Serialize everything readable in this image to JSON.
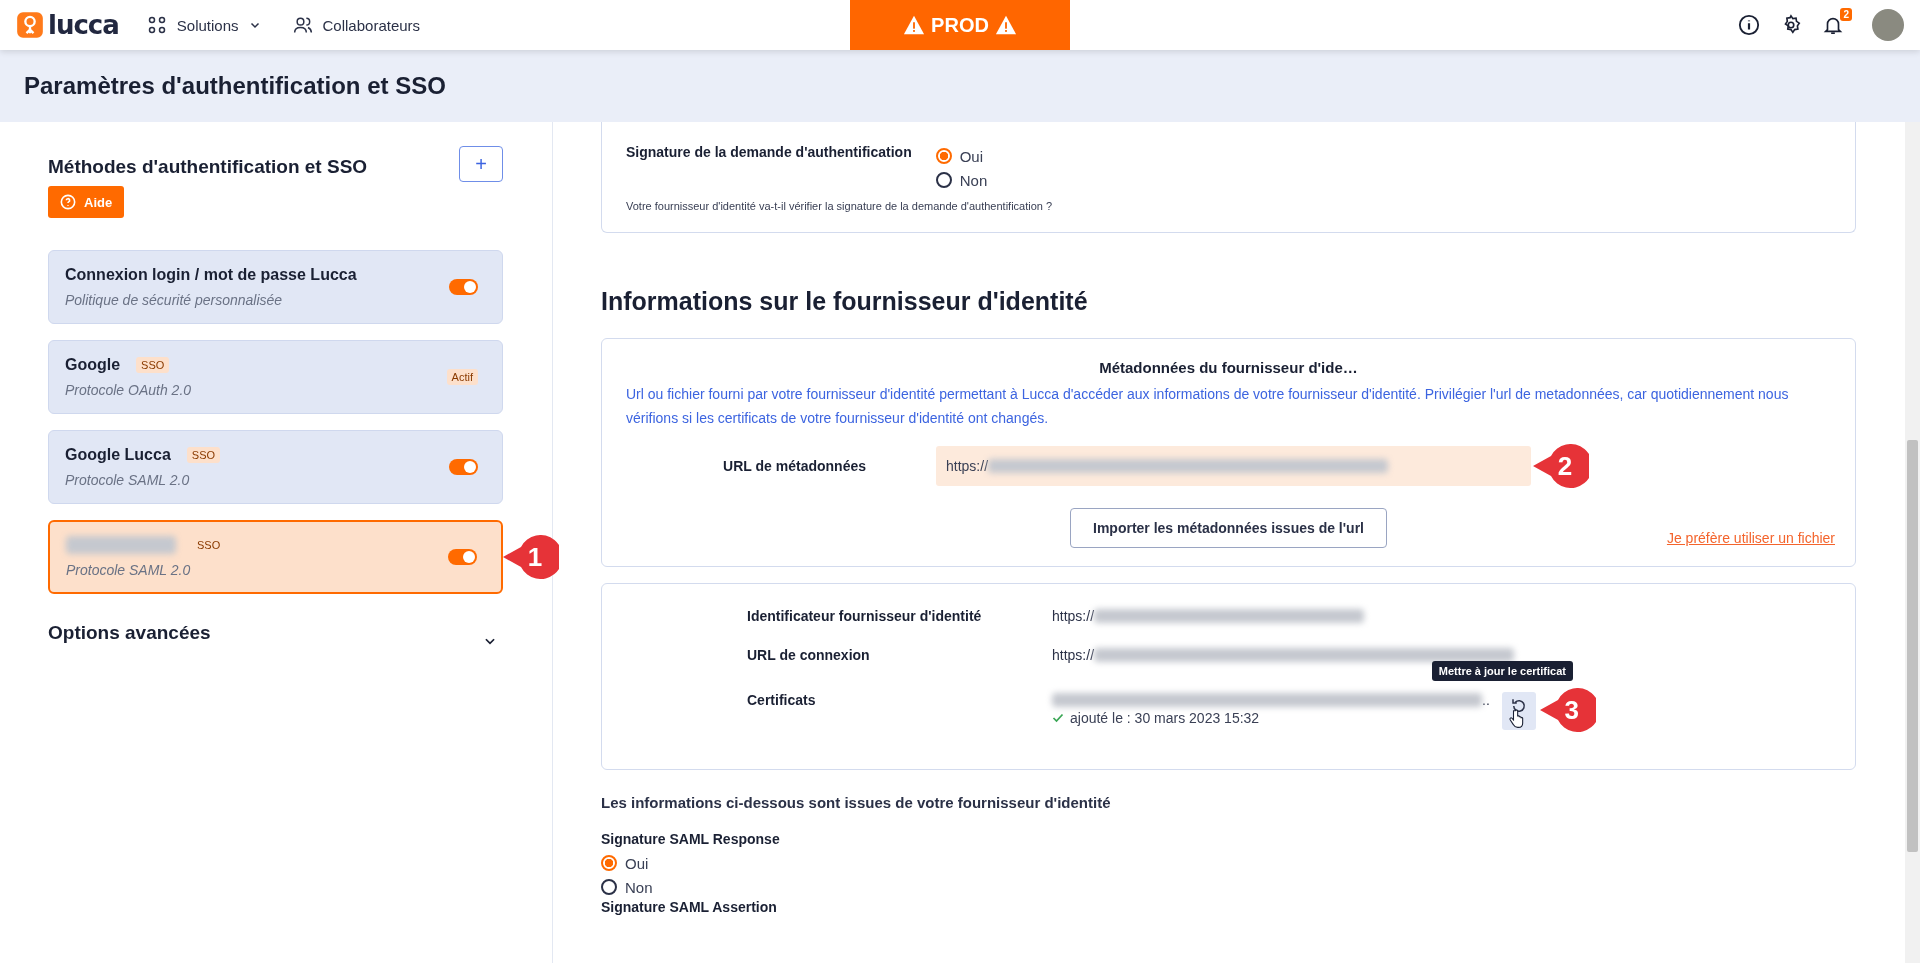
{
  "top_bar": {
    "logo_text": "lucca",
    "nav": [
      {
        "label": "Solutions",
        "kind": "menu"
      },
      {
        "label": "Collaborateurs",
        "kind": "link"
      }
    ],
    "environment_banner": "PROD",
    "notifications_count": "2"
  },
  "page_title": "Paramètres d'authentification et SSO",
  "sidebar": {
    "title": "Méthodes d'authentification et SSO",
    "add_button": "+",
    "help_button": "Aide",
    "methods": [
      {
        "name": "Connexion login / mot de passe Lucca",
        "subtitle": "Politique de sécurité personnalisée",
        "kind": "toggle",
        "on": true,
        "selected": false
      },
      {
        "name": "Google",
        "tag": "SSO",
        "subtitle": "Protocole OAuth 2.0",
        "kind": "status",
        "status": "Actif",
        "selected": false
      },
      {
        "name": "Google Lucca",
        "tag": "SSO",
        "subtitle": "Protocole SAML 2.0",
        "kind": "toggle",
        "on": true,
        "selected": false
      },
      {
        "tag": "SSO",
        "subtitle": "Protocole SAML 2.0",
        "kind": "toggle",
        "on": true,
        "selected": true,
        "callout": "1"
      }
    ],
    "advanced_options": {
      "label": "Options avancées",
      "expanded": false
    }
  },
  "request_signature": {
    "label": "Signature de la demande d'authentification",
    "options": [
      {
        "label": "Oui",
        "selected": true
      },
      {
        "label": "Non",
        "selected": false
      }
    ],
    "hint": "Votre fournisseur d'identité va-t-il vérifier la signature de la demande d'authentification ?"
  },
  "idp_heading": "Informations sur le fournisseur d'identité",
  "metadata": {
    "title": "Métadonnées du fournisseur d'ide…",
    "description": "Url ou fichier fourni par votre fournisseur d'identité permettant à Lucca d'accéder aux informations de votre fournisseur d'identité. Privilégier l'url de metadonnées, car quotidiennement nous vérifions si les certificats de votre fournisseur d'identité ont changés.",
    "url_label": "URL de métadonnées",
    "url_value": "https://",
    "url_callout": "2",
    "import_button": "Importer les métadonnées issues de l'url",
    "file_link": "Je préfère utiliser un fichier"
  },
  "idp_details": {
    "rows": [
      {
        "label": "Identificateur fournisseur d'identité",
        "value": "https://",
        "kind": "url"
      },
      {
        "label": "URL de connexion",
        "value": "https://",
        "kind": "url"
      },
      {
        "label": "Certificats",
        "value": "..",
        "kind": "certificate",
        "added": "ajouté le : 30 mars 2023 15:32"
      }
    ],
    "tooltip": "Mettre à jour le certificat",
    "refresh_callout": "3"
  },
  "idp_note": "Les informations ci-dessous sont issues de votre fournisseur d'identité",
  "saml_settings": [
    {
      "label": "Signature SAML Response",
      "options": [
        {
          "label": "Oui",
          "selected": true
        },
        {
          "label": "Non",
          "selected": false
        }
      ]
    },
    {
      "label": "Signature SAML Assertion"
    }
  ]
}
